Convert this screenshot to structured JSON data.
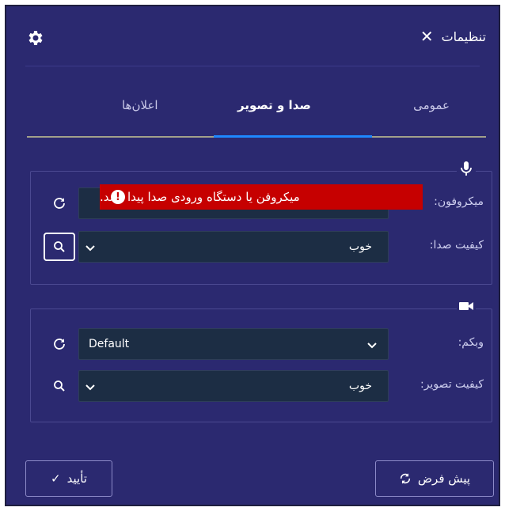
{
  "dialog": {
    "title": "تنظیمات",
    "close_icon": "close-icon",
    "settings_icon": "gear-icon"
  },
  "tabs": [
    {
      "label": "عمومی",
      "active": false
    },
    {
      "label": "صدا و تصویر",
      "active": true
    },
    {
      "label": "اعلان‌ها",
      "active": false
    }
  ],
  "audio": {
    "group_icon": "microphone-icon",
    "microphone_label": "میکروفون:",
    "microphone_value": "",
    "quality_label": "کیفیت صدا:",
    "quality_value": "خوب",
    "error_message": "میکروفن یا دستگاه ورودی صدا پیدا نشد."
  },
  "video": {
    "group_icon": "camera-icon",
    "webcam_label": "وبکم:",
    "webcam_value": "Default",
    "quality_label": "کیفیت تصویر:",
    "quality_value": "خوب"
  },
  "buttons": {
    "ok_label": "تأیید",
    "reset_label": "پیش فرض"
  },
  "colors": {
    "background": "#2b2970",
    "select_bg": "#1c2d44",
    "active_tab_underline": "#1e88ff",
    "error_bg": "#c60000"
  }
}
